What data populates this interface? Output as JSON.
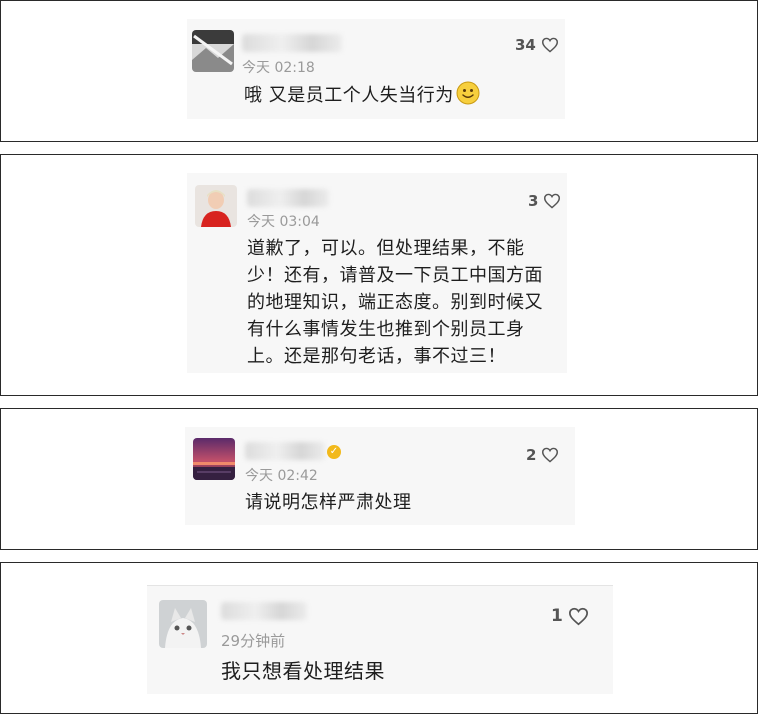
{
  "comments": [
    {
      "time": "今天 02:18",
      "likes": "34",
      "text_lines": [
        "哦 又是员工个人失当行为"
      ],
      "avatar_icon": "landscape-avatar-icon",
      "emoji": "slightly-smiling-face-icon"
    },
    {
      "time": "今天 03:04",
      "likes": "3",
      "text_lines": [
        "道歉了，可以。但处理结果，不能",
        "少！还有，请普及一下员工中国方面",
        "的地理知识，端正态度。别到时候又",
        "有什么事情发生也推到个别员工身",
        "上。还是那句老话，事不过三！"
      ],
      "avatar_icon": "person-red-shirt-avatar-icon"
    },
    {
      "time": "今天 02:42",
      "likes": "2",
      "text_lines": [
        "请说明怎样严肃处理"
      ],
      "avatar_icon": "sunset-avatar-icon",
      "verified_icon": "verified-badge-icon"
    },
    {
      "time": "29分钟前",
      "likes": "1",
      "text_lines": [
        "我只想看处理结果"
      ],
      "avatar_icon": "cat-avatar-icon"
    }
  ],
  "colors": {
    "like_heart": "#555555",
    "verified": "#f2b91b",
    "time": "#9a9a9a"
  }
}
